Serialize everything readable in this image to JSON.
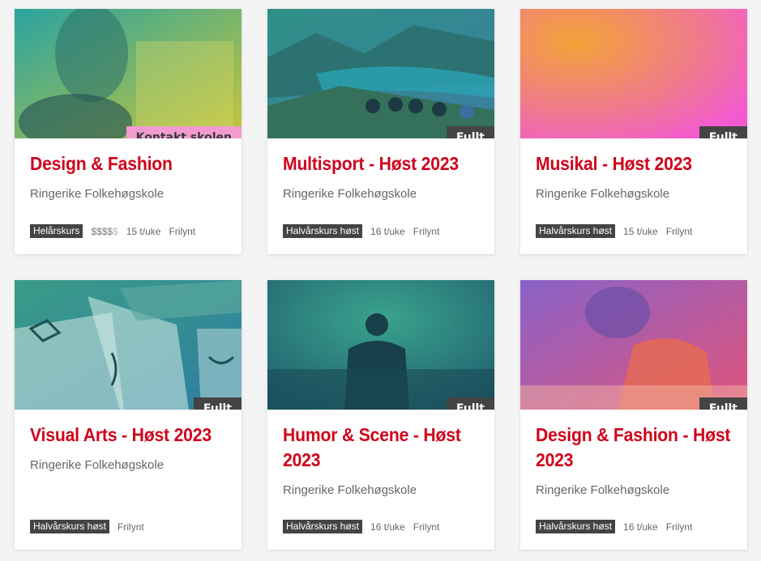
{
  "courses": [
    {
      "title": "Design & Fashion",
      "school": "Ringerike Folkehøgskole",
      "badge": "Kontakt skolen",
      "type": "Helårskurs",
      "price_filled": "$$$$",
      "price_empty": "$",
      "hours": "15 t/uke",
      "mode": "Frilynt",
      "colors": {
        "from": "#2aa3a0",
        "to": "#c6c63a"
      }
    },
    {
      "title": "Multisport - Høst 2023",
      "school": "Ringerike Folkehøgskole",
      "badge": "Fullt",
      "type": "Halvårskurs høst",
      "hours": "16 t/uke",
      "mode": "Frilynt",
      "colors": {
        "from": "#2f8f86",
        "to": "#3a7fa1"
      }
    },
    {
      "title": "Musikal - Høst 2023",
      "school": "Ringerike Folkehøgskole",
      "badge": "Fullt",
      "type": "Halvårskurs høst",
      "hours": "15 t/uke",
      "mode": "Frilynt",
      "colors": {
        "from": "#f3a338",
        "to": "#f25bd0"
      }
    },
    {
      "title": "Visual Arts - Høst 2023",
      "school": "Ringerike Folkehøgskole",
      "badge": "Fullt",
      "type": "Halvårskurs høst",
      "mode": "Frilynt",
      "colors": {
        "from": "#3b9b88",
        "to": "#2e7ea0"
      }
    },
    {
      "title": "Humor & Scene - Høst 2023",
      "school": "Ringerike Folkehøgskole",
      "badge": "Fullt",
      "type": "Halvårskurs høst",
      "hours": "16 t/uke",
      "mode": "Frilynt",
      "colors": {
        "from": "#2d8e7c",
        "to": "#225f77"
      }
    },
    {
      "title": "Design & Fashion - Høst 2023",
      "school": "Ringerike Folkehøgskole",
      "badge": "Fullt",
      "type": "Halvårskurs høst",
      "hours": "16 t/uke",
      "mode": "Frilynt",
      "colors": {
        "from": "#8a63c9",
        "to": "#e0537a"
      }
    }
  ]
}
